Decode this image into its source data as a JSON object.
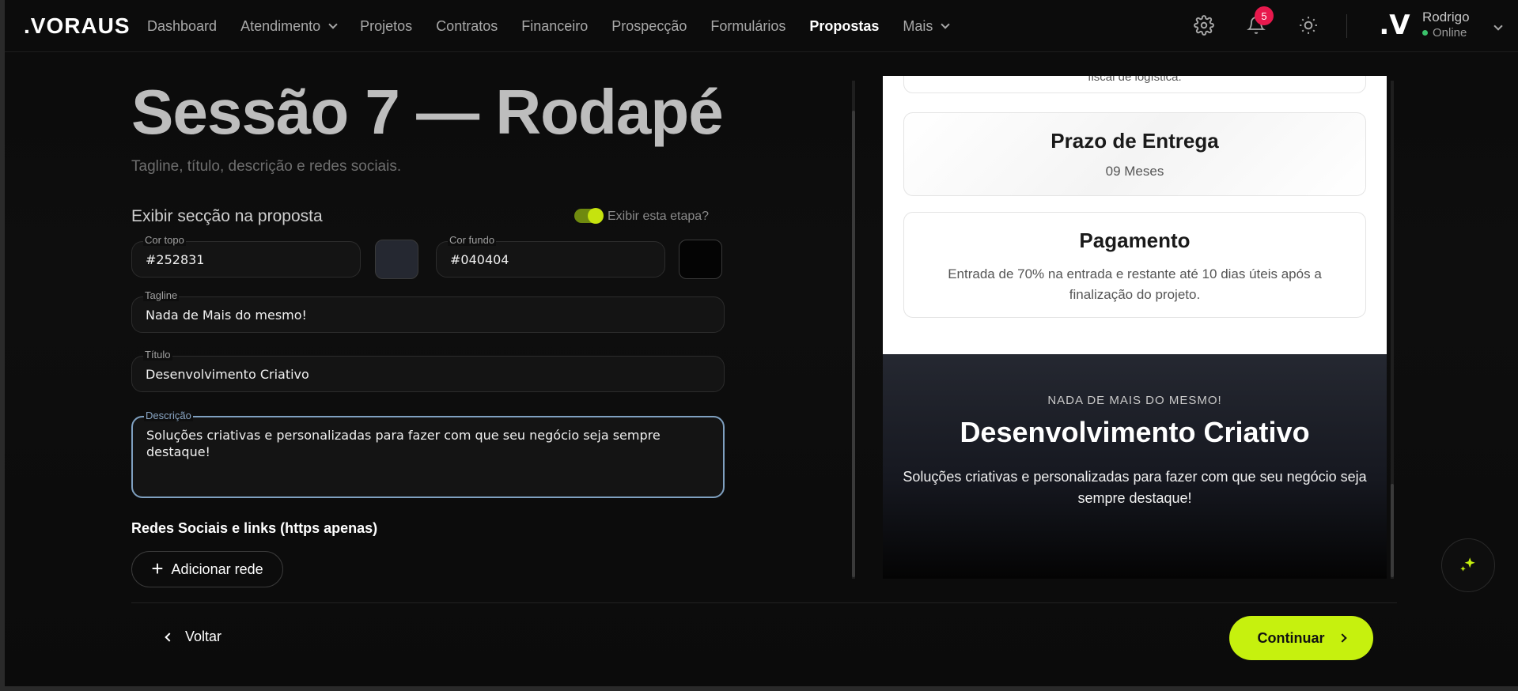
{
  "brand": {
    "logo_text": ".VORAUS",
    "accent": "#c6f10e",
    "notification_color": "#e8194d"
  },
  "nav": {
    "items": [
      {
        "label": "Dashboard",
        "dropdown": false,
        "active": false
      },
      {
        "label": "Atendimento",
        "dropdown": true,
        "active": false
      },
      {
        "label": "Projetos",
        "dropdown": false,
        "active": false
      },
      {
        "label": "Contratos",
        "dropdown": false,
        "active": false
      },
      {
        "label": "Financeiro",
        "dropdown": false,
        "active": false
      },
      {
        "label": "Prospecção",
        "dropdown": false,
        "active": false
      },
      {
        "label": "Formulários",
        "dropdown": false,
        "active": false
      },
      {
        "label": "Propostas",
        "dropdown": false,
        "active": true
      },
      {
        "label": "Mais",
        "dropdown": true,
        "active": false
      }
    ]
  },
  "header_icons": {
    "settings": "gear-icon",
    "notifications": "bell-icon",
    "theme": "sun-icon",
    "notification_count": "5"
  },
  "user": {
    "avatar_text": ".V",
    "name": "Rodrigo",
    "status": "Online"
  },
  "form": {
    "title": "Sessão 7 — Rodapé",
    "subtitle": "Tagline, título, descrição e redes sociais.",
    "section_label": "Exibir secção na proposta",
    "toggle_label": "Exibir esta etapa?",
    "toggle_on": true,
    "cor_topo": {
      "label": "Cor topo",
      "value": "#252831"
    },
    "cor_fundo": {
      "label": "Cor fundo",
      "value": "#040404"
    },
    "tagline": {
      "label": "Tagline",
      "value": "Nada de Mais do mesmo!"
    },
    "titulo": {
      "label": "Título",
      "value": "Desenvolvimento Criativo"
    },
    "descricao": {
      "label": "Descrição",
      "value": "Soluções criativas e personalizadas para fazer com que seu negócio seja sempre destaque!"
    },
    "social_title": "Redes Sociais e links (https apenas)",
    "add_social_label": "Adicionar rede"
  },
  "preview": {
    "cropped_text": "fiscal de logística.",
    "cards": [
      {
        "title": "Prazo de Entrega",
        "text": "09 Meses"
      },
      {
        "title": "Pagamento",
        "text": "Entrada de 70% na entrada e restante até 10 dias úteis após a finalização do projeto."
      }
    ],
    "footer": {
      "tagline": "NADA DE MAIS DO MESMO!",
      "title": "Desenvolvimento Criativo",
      "description": "Soluções criativas e personalizadas para fazer com que seu negócio seja sempre destaque!"
    }
  },
  "actions": {
    "back": "Voltar",
    "continue": "Continuar",
    "ai_button": "sparkle-icon"
  }
}
